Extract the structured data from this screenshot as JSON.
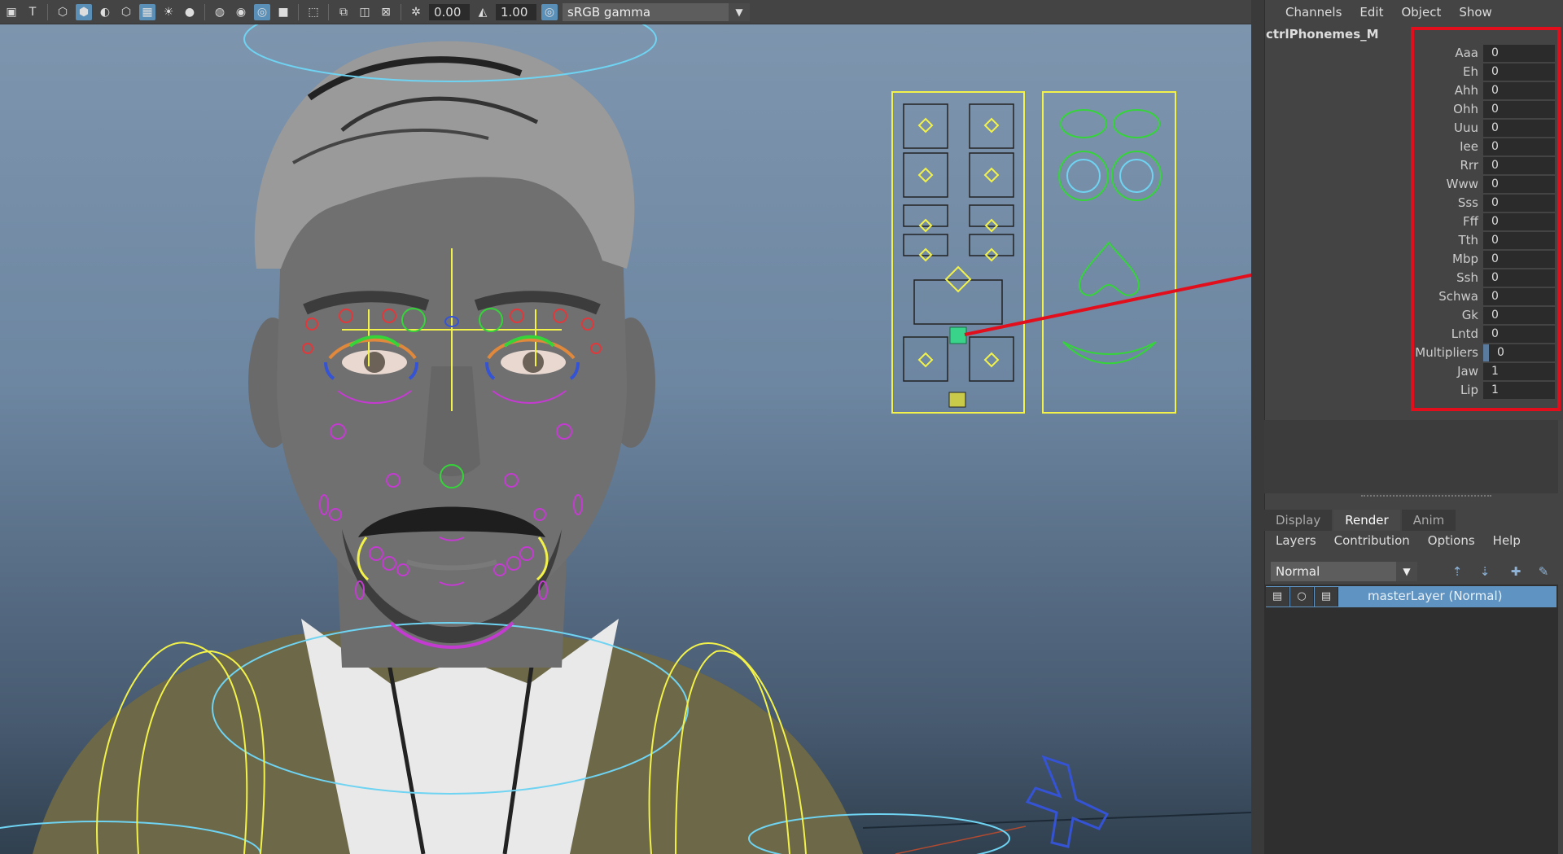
{
  "toolbar": {
    "exposure_value": "0.00",
    "gamma_value": "1.00",
    "color_space": "sRGB gamma",
    "icons": [
      "image-plane-icon",
      "text-icon",
      "wireframe-icon",
      "shaded-icon",
      "smooth-shade-icon",
      "bounding-box-icon",
      "textured-icon",
      "light-icon",
      "shadow-icon",
      "ambient-occlusion-icon",
      "isolate-icon",
      "xray-icon",
      "select-icon",
      "snapshot-icon",
      "frame-icon",
      "camera-gate-icon",
      "exposure-icon",
      "gamma-icon",
      "color-management-icon"
    ]
  },
  "channel_box": {
    "menu": [
      "Channels",
      "Edit",
      "Object",
      "Show"
    ],
    "object_name": "ctrlPhonemes_M",
    "channels": [
      {
        "label": "Aaa",
        "value": "0"
      },
      {
        "label": "Eh",
        "value": "0"
      },
      {
        "label": "Ahh",
        "value": "0"
      },
      {
        "label": "Ohh",
        "value": "0"
      },
      {
        "label": "Uuu",
        "value": "0"
      },
      {
        "label": "Iee",
        "value": "0"
      },
      {
        "label": "Rrr",
        "value": "0"
      },
      {
        "label": "Www",
        "value": "0"
      },
      {
        "label": "Sss",
        "value": "0"
      },
      {
        "label": "Fff",
        "value": "0"
      },
      {
        "label": "Tth",
        "value": "0"
      },
      {
        "label": "Mbp",
        "value": "0"
      },
      {
        "label": "Ssh",
        "value": "0"
      },
      {
        "label": "Schwa",
        "value": "0"
      },
      {
        "label": "Gk",
        "value": "0"
      },
      {
        "label": "Lntd",
        "value": "0"
      },
      {
        "label": "Multipliers",
        "value": "0"
      },
      {
        "label": "Jaw",
        "value": "1"
      },
      {
        "label": "Lip",
        "value": "1"
      }
    ],
    "highlight_color": "#e30e1b"
  },
  "layer_editor": {
    "tabs": [
      "Display",
      "Render",
      "Anim"
    ],
    "active_tab": "Render",
    "menu": [
      "Layers",
      "Contribution",
      "Options",
      "Help"
    ],
    "mode": "Normal",
    "layer_name": "masterLayer (Normal)"
  },
  "colors": {
    "annotation": "#e30e1b",
    "ctrl_yellow": "#f2f24a",
    "ctrl_green": "#35d53a",
    "ctrl_blue": "#6fd3f2",
    "ctrl_magenta": "#c43bd1",
    "ctrl_red": "#e0383b"
  }
}
